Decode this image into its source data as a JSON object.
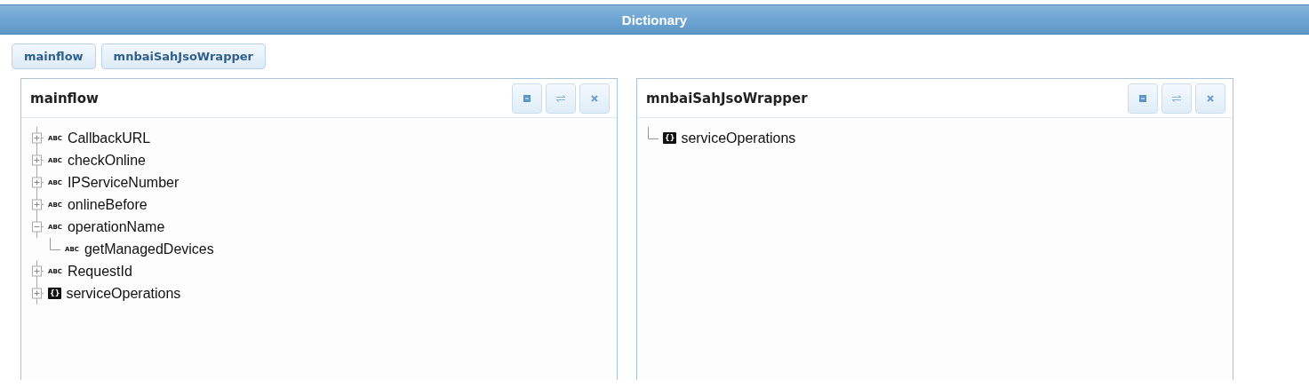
{
  "window": {
    "title": "Dictionary"
  },
  "tabs": [
    {
      "label": "mainflow"
    },
    {
      "label": "mnbaiSahJsoWrapper"
    }
  ],
  "panels": [
    {
      "title": "mainflow",
      "tree": [
        {
          "label": "CallbackURL",
          "kind": "string",
          "badge": "ABC",
          "expanded": false
        },
        {
          "label": "checkOnline",
          "kind": "string",
          "badge": "ABC",
          "expanded": false
        },
        {
          "label": "IPServiceNumber",
          "kind": "string",
          "badge": "ABC",
          "expanded": false
        },
        {
          "label": "onlineBefore",
          "kind": "string",
          "badge": "ABC",
          "expanded": false
        },
        {
          "label": "operationName",
          "kind": "string",
          "badge": "ABC",
          "expanded": true,
          "children": [
            {
              "label": "getManagedDevices",
              "kind": "string",
              "badge": "ABC"
            }
          ]
        },
        {
          "label": "RequestId",
          "kind": "string",
          "badge": "ABC",
          "expanded": false
        },
        {
          "label": "serviceOperations",
          "kind": "object",
          "badge": "{}",
          "expanded": false
        }
      ]
    },
    {
      "title": "mnbaiSahJsoWrapper",
      "tree": [
        {
          "label": "serviceOperations",
          "kind": "object",
          "badge": "{}"
        }
      ]
    }
  ]
}
